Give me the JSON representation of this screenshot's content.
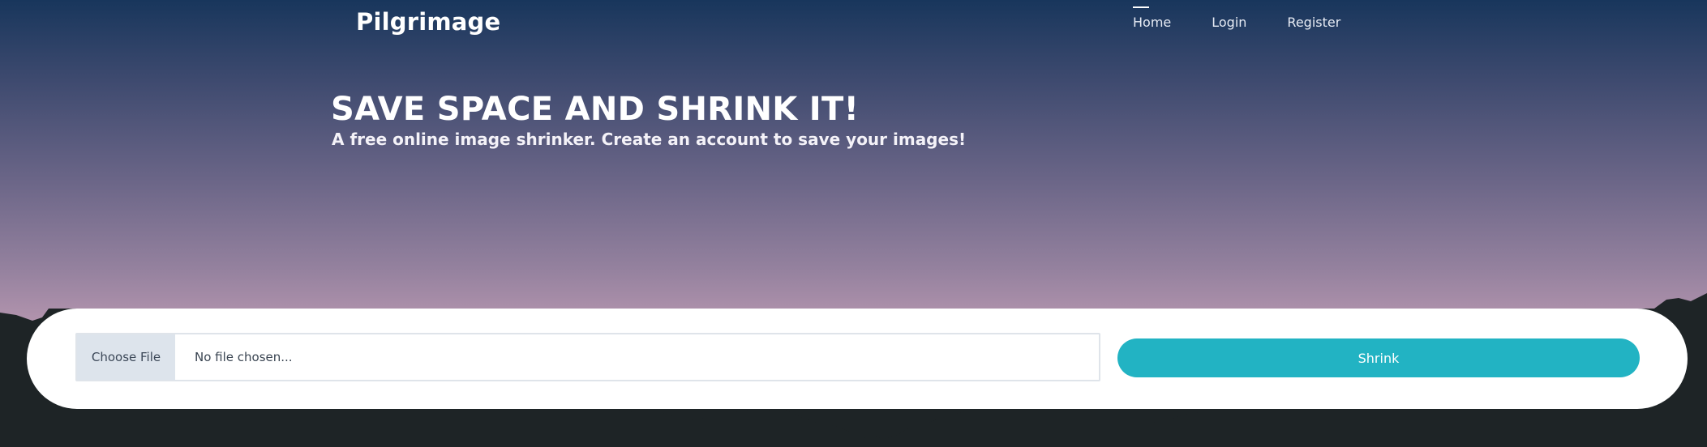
{
  "brand": {
    "name": "Pilgrimage"
  },
  "nav": {
    "home": "Home",
    "login": "Login",
    "register": "Register"
  },
  "hero": {
    "title": "SAVE SPACE AND SHRINK IT!",
    "subtitle": "A free online image shrinker. Create an account to save your images!"
  },
  "upload": {
    "choose_label": "Choose File",
    "file_placeholder": "No file chosen...",
    "shrink_label": "Shrink"
  },
  "colors": {
    "accent": "#22b3c3",
    "mountain": "#1e2426",
    "sky_top": "#18365c",
    "sky_bottom": "#e2a9bb"
  }
}
